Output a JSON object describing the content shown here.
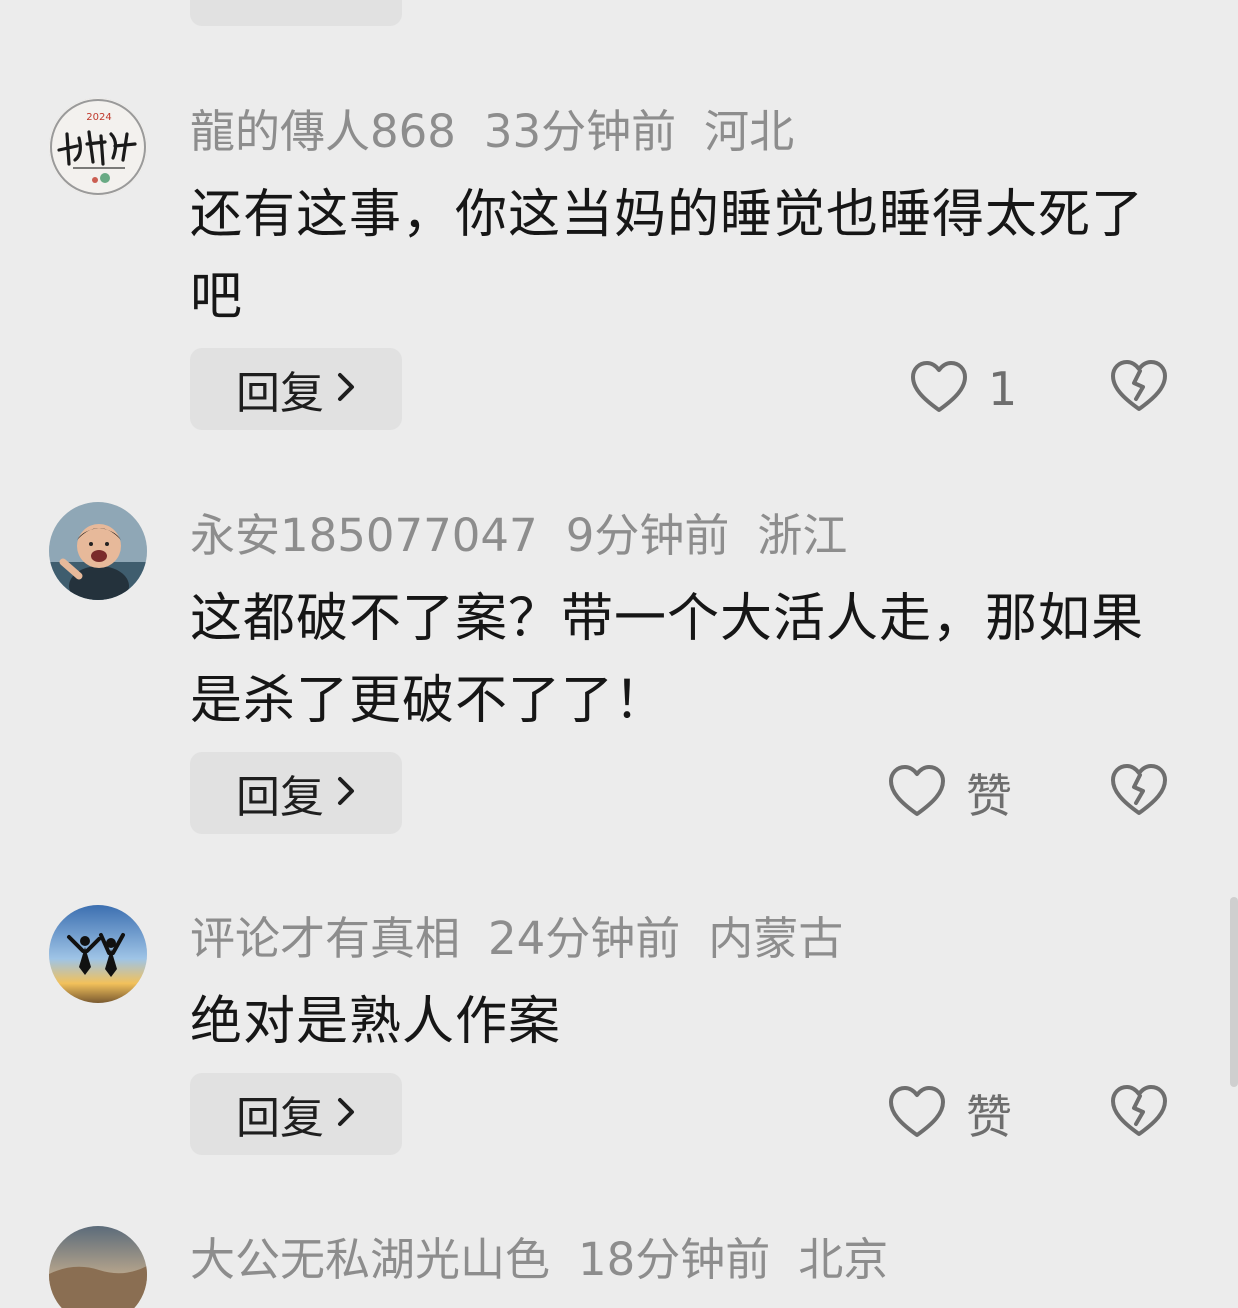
{
  "comments": [
    {
      "username": "龍的傳人868",
      "time": "33分钟前",
      "location": "河北",
      "text": "还有这事，你这当妈的睡觉也睡得太死了吧",
      "reply_label": "回复",
      "like_label": "1",
      "avatar_icon": "calligraphy-avatar"
    },
    {
      "username": "永安185077047",
      "time": "9分钟前",
      "location": "浙江",
      "text": "这都破不了案？带一个大活人走，那如果是杀了更破不了了！",
      "reply_label": "回复",
      "like_label": "赞",
      "avatar_icon": "child-photo-avatar"
    },
    {
      "username": "评论才有真相",
      "time": "24分钟前",
      "location": "内蒙古",
      "text": "绝对是熟人作案",
      "reply_label": "回复",
      "like_label": "赞",
      "avatar_icon": "sunset-jump-avatar"
    },
    {
      "username": "大公无私湖光山色",
      "time": "18分钟前",
      "location": "北京",
      "avatar_icon": "landscape-avatar"
    }
  ],
  "colors": {
    "background": "#ececec",
    "meta_text": "#8d8d8d",
    "body_text": "#161616",
    "button_bg": "#e1e1e1",
    "icon_stroke": "#6e6e6e"
  }
}
